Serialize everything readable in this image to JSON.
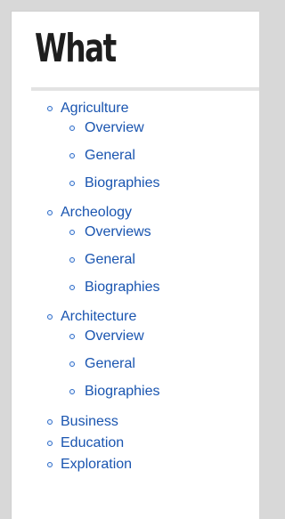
{
  "heading": "What",
  "categories": [
    {
      "label": "Agriculture",
      "subitems": [
        "Overview",
        "General",
        "Biographies"
      ]
    },
    {
      "label": "Archeology",
      "subitems": [
        "Overviews",
        "General",
        "Biographies"
      ]
    },
    {
      "label": "Architecture",
      "subitems": [
        "Overview",
        "General",
        "Biographies"
      ]
    },
    {
      "label": "Business"
    },
    {
      "label": "Education"
    },
    {
      "label": "Exploration"
    }
  ],
  "colors": {
    "link": "#1a55b0",
    "heading": "#1e1e1e",
    "background": "#d8d8d8",
    "panel": "#ffffff"
  }
}
